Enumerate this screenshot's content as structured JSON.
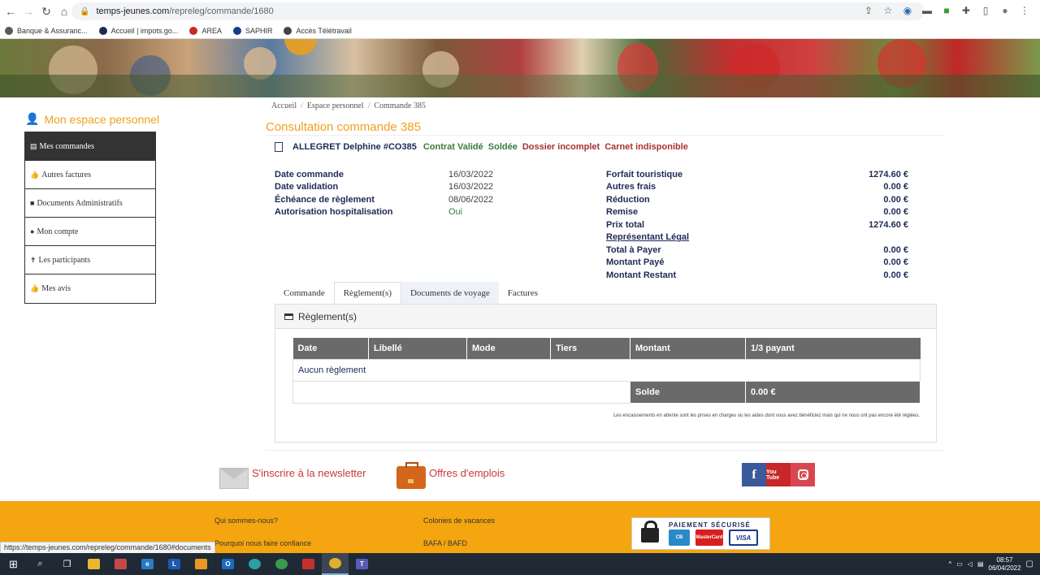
{
  "browser": {
    "url_host": "temps-jeunes.com",
    "url_path": "/repreleg/commande/1680",
    "bookmarks": [
      {
        "label": "Banque & Assuranc...",
        "color": "#5a5a5a"
      },
      {
        "label": "Accueil | impots.go...",
        "color": "#1e2a56"
      },
      {
        "label": "AREA",
        "color": "#c82828"
      },
      {
        "label": "SAPHIR",
        "color": "#1a3a8a"
      },
      {
        "label": "Accès Télétravail",
        "color": "#444444"
      }
    ],
    "status_url": "https://temps-jeunes.com/repreleg/commande/1680#documents"
  },
  "sidebar": {
    "title": "Mon espace personnel",
    "items": [
      {
        "label": "Mes commandes",
        "icon": "list-icon",
        "glyph": "▤",
        "active": true
      },
      {
        "label": "Autres factures",
        "icon": "thumbs-up-icon",
        "glyph": "👍",
        "active": false
      },
      {
        "label": "Documents Administratifs",
        "icon": "folder-icon",
        "glyph": "■",
        "active": false
      },
      {
        "label": "Mon compte",
        "icon": "user-icon",
        "glyph": "●",
        "active": false
      },
      {
        "label": "Les participants",
        "icon": "person-icon",
        "glyph": "✝",
        "active": false
      },
      {
        "label": "Mes avis",
        "icon": "thumbs-up-icon",
        "glyph": "👍",
        "active": false
      }
    ]
  },
  "breadcrumb": [
    "Accueil",
    "Espace personnel",
    "Commande 385"
  ],
  "page_title": "Consultation commande 385",
  "order": {
    "name": "ALLEGRET Delphine #CO385",
    "statuses": [
      {
        "label": "Contrat Validé",
        "tone": "green"
      },
      {
        "label": "Soldée",
        "tone": "green"
      },
      {
        "label": "Dossier incomplet",
        "tone": "red"
      },
      {
        "label": "Carnet indisponible",
        "tone": "red"
      }
    ]
  },
  "details_left": [
    {
      "label": "Date commande",
      "value": "16/03/2022"
    },
    {
      "label": "Date validation",
      "value": "16/03/2022"
    },
    {
      "label": "Échéance de règlement",
      "value": "08/06/2022"
    },
    {
      "label": "Autorisation hospitalisation",
      "value": "Oui"
    }
  ],
  "details_right": [
    {
      "label": "Forfait touristique",
      "value": "1274.60 €"
    },
    {
      "label": "Autres frais",
      "value": "0.00 €"
    },
    {
      "label": "Réduction",
      "value": "0.00 €"
    },
    {
      "label": "Remise",
      "value": "0.00 €"
    },
    {
      "label": "Prix total",
      "value": "1274.60 €"
    },
    {
      "label": "Représentant Légal",
      "value": ""
    },
    {
      "label": "Total à Payer",
      "value": "0.00 €"
    },
    {
      "label": "Montant Payé",
      "value": "0.00 €"
    },
    {
      "label": "Montant Restant",
      "value": "0.00 €"
    }
  ],
  "tabs": [
    "Commande",
    "Règlement(s)",
    "Documents de voyage",
    "Factures"
  ],
  "payments": {
    "title": "Règlement(s)",
    "columns": [
      "Date",
      "Libellé",
      "Mode",
      "Tiers",
      "Montant",
      "1/3 payant"
    ],
    "empty_text": "Aucun règlement",
    "balance_label": "Solde",
    "balance_value": "0.00 €",
    "note": "Les encaissements en attente sont les prises en charges ou les aides dont vous avez bénéficiez mais qui ne nous ont pas encore été réglées."
  },
  "promo": {
    "newsletter": "S'inscrire à la newsletter",
    "jobs": "Offres d'emplois"
  },
  "social": {
    "facebook": "f",
    "youtube": "You Tube"
  },
  "footer": {
    "links_col1": [
      "Qui sommes-nous?",
      "Pourquoi nous faire confiance"
    ],
    "links_col2": [
      "Colonies de vacances",
      "BAFA / BAFD"
    ],
    "secure_title": "PAIEMENT SÉCURISÉ",
    "cards": [
      "CB",
      "MasterCard",
      "VISA"
    ]
  },
  "taskbar": {
    "time": "08:57",
    "date": "06/04/2022"
  }
}
